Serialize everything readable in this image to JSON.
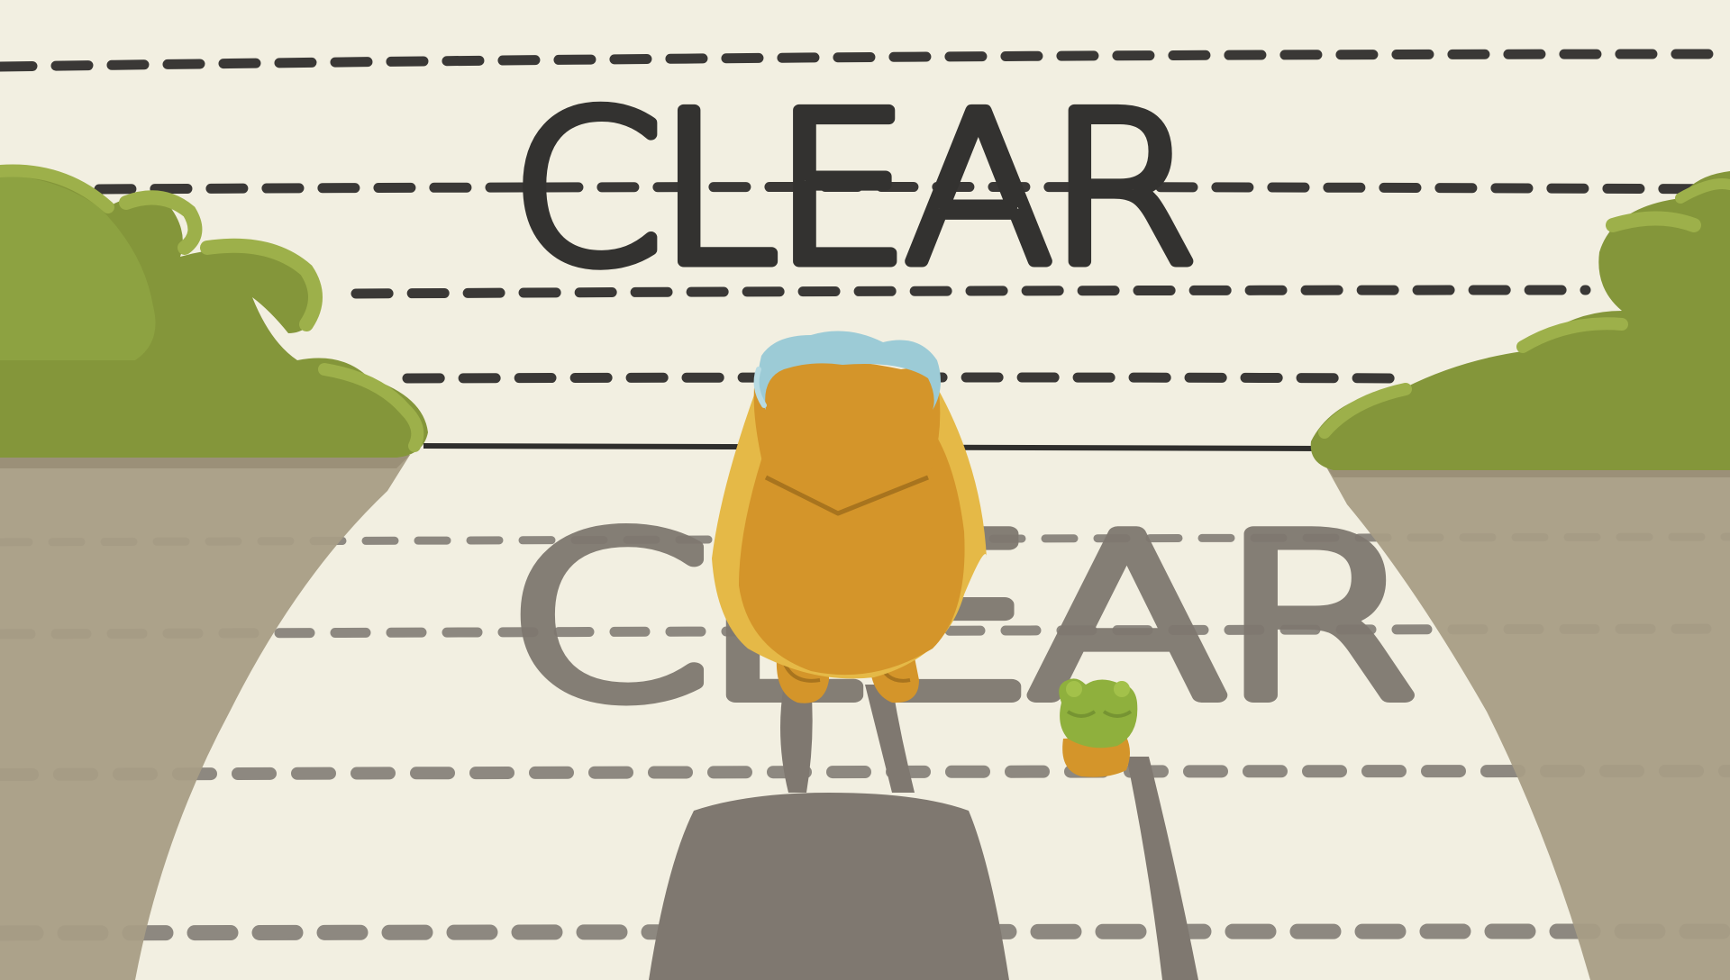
{
  "title_screen": {
    "top_word": "CLEAR",
    "shadow_word": "CLEAR"
  },
  "colors": {
    "background": "#f2efe1",
    "ink": "#333230",
    "raincoat": "#d4952a",
    "raincoat_light": "#e5b947",
    "hair": "#9ccbd6",
    "bush": "#84963a",
    "bush_light": "#9db04a",
    "cliff": "#a89d85",
    "shadow": "#7f7870",
    "frog": "#8fb03d"
  },
  "icons": {
    "character": "raincoat-child",
    "companion": "frog",
    "scenery": [
      "left-bush-cliff",
      "right-bush-cliff"
    ]
  }
}
